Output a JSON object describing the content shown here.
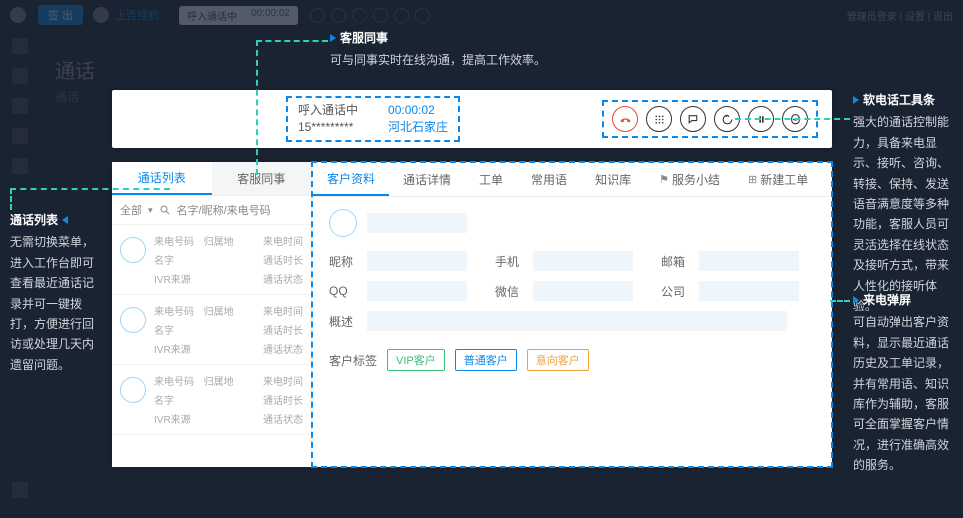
{
  "bg": {
    "logout": "签 出",
    "topText": "上否挂机",
    "callStatus": "呼入通话中",
    "callTimer": "00:00:02",
    "topRight": "管理员登录 | 设置 | 退出",
    "title": "通话",
    "subtab": "通话"
  },
  "softphone": {
    "status": "呼入通话中",
    "number": "15*********",
    "timer": "00:00:02",
    "location": "河北石家庄"
  },
  "ann": {
    "top": {
      "head": "客服同事",
      "body": "可与同事实时在线沟通，提高工作效率。"
    },
    "left": {
      "head": "通话列表",
      "body": "无需切换菜单，进入工作台即可查看最近通话记录并可一键拨打，方便进行回访或处理几天内遗留问题。"
    },
    "r1": {
      "head": "软电话工具条",
      "body": "强大的通话控制能力，具备来电显示、接听、咨询、转接、保持、发送语音满意度等多种功能，客服人员可灵活选择在线状态及接听方式，带来人性化的接听体验。"
    },
    "r2": {
      "head": "来电弹屏",
      "body": "可自动弹出客户资料，显示最近通话历史及工单记录，并有常用语、知识库作为辅助，客服可全面掌握客户情况，进行准确高效的服务。"
    }
  },
  "callList": {
    "tabs": {
      "a": "通话列表",
      "b": "客服同事"
    },
    "filterAll": "全部",
    "searchPlaceholder": "名字/昵称/来电号码",
    "labels": {
      "caller": "来电号码",
      "region": "归属地",
      "time": "来电时间",
      "name": "名字",
      "duration": "通话时长",
      "ivr": "IVR来源",
      "status": "通话状态"
    }
  },
  "profile": {
    "tabs": {
      "a": "客户资料",
      "b": "通话详情",
      "c": "工单",
      "d": "常用语",
      "e": "知识库",
      "f": "服务小结",
      "g": "新建工单"
    },
    "fields": {
      "nick": "昵称",
      "mobile": "手机",
      "email": "邮箱",
      "qq": "QQ",
      "wechat": "微信",
      "company": "公司",
      "desc": "概述",
      "tags": "客户标签"
    },
    "tags": {
      "vip": "VIP客户",
      "normal": "普通客户",
      "intent": "意向客户"
    }
  }
}
